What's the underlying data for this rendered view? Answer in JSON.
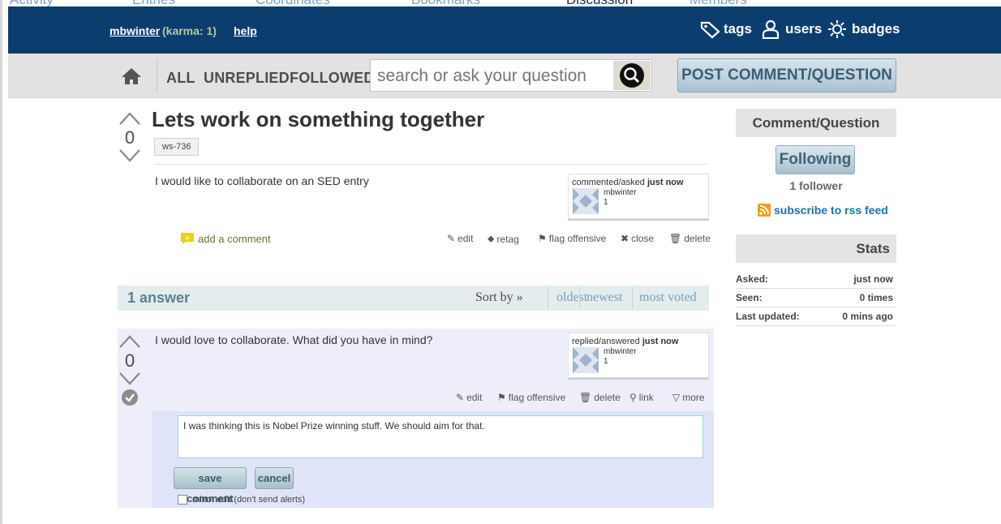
{
  "top_tabs": [
    "Activity",
    "Entries",
    "Coordinates",
    "Bookmarks",
    "Discussion",
    "Members"
  ],
  "header": {
    "username": "mbwinter",
    "karma": "(karma: 1)",
    "help": "help",
    "nav": {
      "tags": "tags",
      "users": "users",
      "badges": "badges"
    }
  },
  "subbar": {
    "scopes": {
      "all": "ALL",
      "unreplied": "UNREPLIED",
      "followed": "FOLLOWED"
    },
    "search_placeholder": "search or ask your question",
    "post_button": "POST COMMENT/QUESTION"
  },
  "question": {
    "votes": "0",
    "title": "Lets work on something together",
    "tag": "ws-736",
    "body": "I would like to collaborate on an SED entry",
    "meta": {
      "action": "commented/asked",
      "when": "just now",
      "user": "mbwinter",
      "rep": "1"
    },
    "add_comment": "add a comment",
    "actions": {
      "edit": "edit",
      "retag": "retag",
      "flag": "flag offensive",
      "close": "close",
      "delete": "delete"
    }
  },
  "answers_header": {
    "count": "1 answer",
    "sort_label": "Sort by »",
    "sort_options": {
      "oldest": "oldest",
      "newest": "newest",
      "most_voted": "most voted"
    }
  },
  "answer": {
    "votes": "0",
    "body": "I would love to collaborate. What did you have in mind?",
    "meta": {
      "action": "replied/answered",
      "when": "just now",
      "user": "mbwinter",
      "rep": "1"
    },
    "actions": {
      "edit": "edit",
      "flag": "flag offensive",
      "delete": "delete",
      "link": "link",
      "more": "more"
    },
    "comment_text": "I was thinking this is Nobel Prize winning stuff. We should aim for that.",
    "save_comment": "save comment",
    "cancel": "cancel",
    "minor_edit": "minor edit (don't send alerts)"
  },
  "sidebar": {
    "tools_title": "Comment/Question Tools",
    "following_button": "Following",
    "followers": "1 follower",
    "rss": "subscribe to rss feed",
    "stats_title": "Stats",
    "stats": {
      "asked": {
        "label": "Asked:",
        "value": "just now"
      },
      "seen": {
        "label": "Seen:",
        "value": "0 times"
      },
      "updated": {
        "label": "Last updated:",
        "value": "0 mins ago"
      }
    }
  },
  "colors": {
    "header_bg": "#0b3d6f",
    "link": "#1a72b0",
    "answer_bg": "#eeeefa"
  }
}
